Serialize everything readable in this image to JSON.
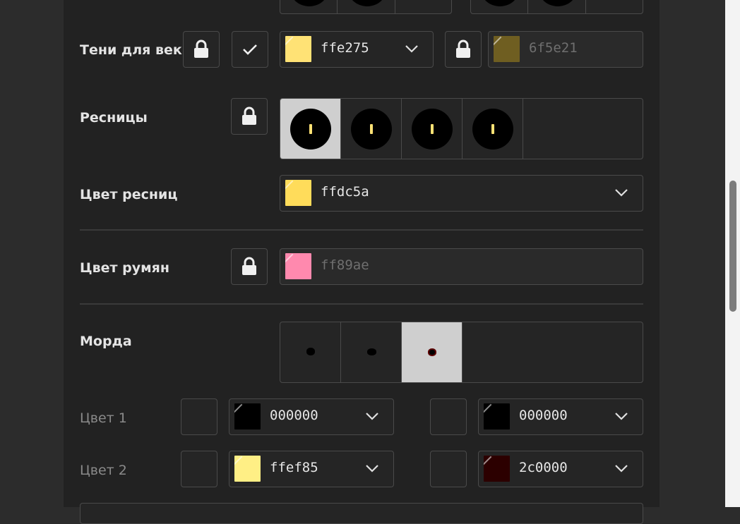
{
  "eyeshadow": {
    "label": "Тени для век",
    "color1": "ffe275",
    "color1_swatch": "#ffe275",
    "color2": "6f5e21",
    "color2_swatch": "#6f5e21"
  },
  "lashes": {
    "label": "Ресницы",
    "styles_count": 4,
    "selected_index": 0
  },
  "lash_color": {
    "label": "Цвет ресниц",
    "value": "ffdc5a",
    "swatch": "#ffdc5a"
  },
  "blush": {
    "label": "Цвет румян",
    "value": "ff89ae",
    "swatch": "#ff89ae"
  },
  "muzzle": {
    "label": "Морда",
    "selected_index": 2,
    "color1_label": "Цвет 1",
    "color1_left": "000000",
    "color1_left_swatch": "#000000",
    "color1_right": "000000",
    "color1_right_swatch": "#000000",
    "color2_label": "Цвет 2",
    "color2_left": "ffef85",
    "color2_left_swatch": "#ffef85",
    "color2_right": "2c0000",
    "color2_right_swatch": "#2c0000"
  }
}
